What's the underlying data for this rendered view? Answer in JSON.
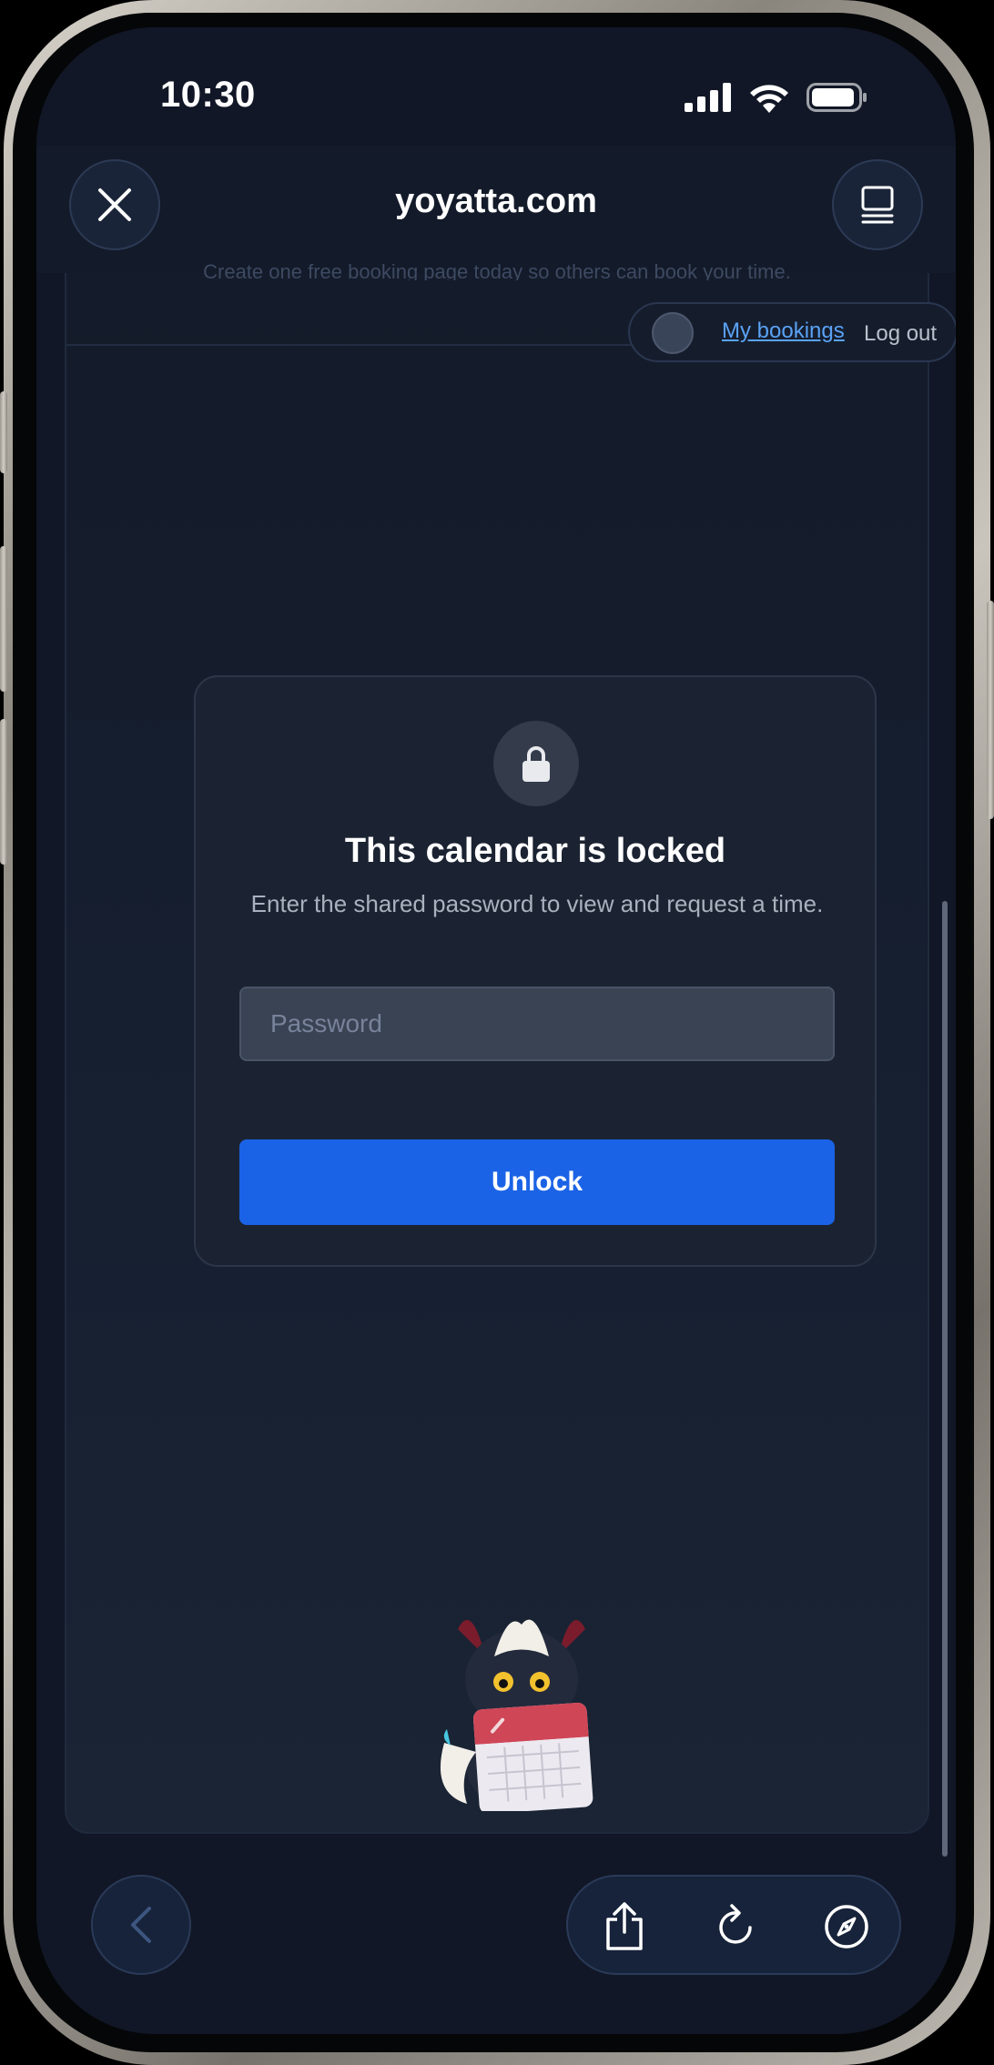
{
  "status_bar": {
    "time": "10:30",
    "icons": [
      "cellular-signal-icon",
      "wifi-icon",
      "battery-icon"
    ]
  },
  "browser": {
    "url": "yoyatta.com",
    "close_icon": "close-icon",
    "tabs_icon": "tab-overview-icon"
  },
  "page": {
    "cut_off_text": "Create one free booking page today so others can book your time.",
    "user_menu": {
      "my_bookings": "My bookings",
      "log_out": "Log out"
    }
  },
  "lock_card": {
    "title": "This calendar is locked",
    "subtitle": "Enter the shared password to view and request a time.",
    "password_placeholder": "Password",
    "password_value": "",
    "unlock_label": "Unlock"
  },
  "toolbar": {
    "icons": [
      "back-icon",
      "share-icon",
      "reload-icon",
      "compass-icon"
    ]
  },
  "colors": {
    "background": "#111726",
    "accent": "#1b63e6",
    "link": "#5aa2f5"
  }
}
